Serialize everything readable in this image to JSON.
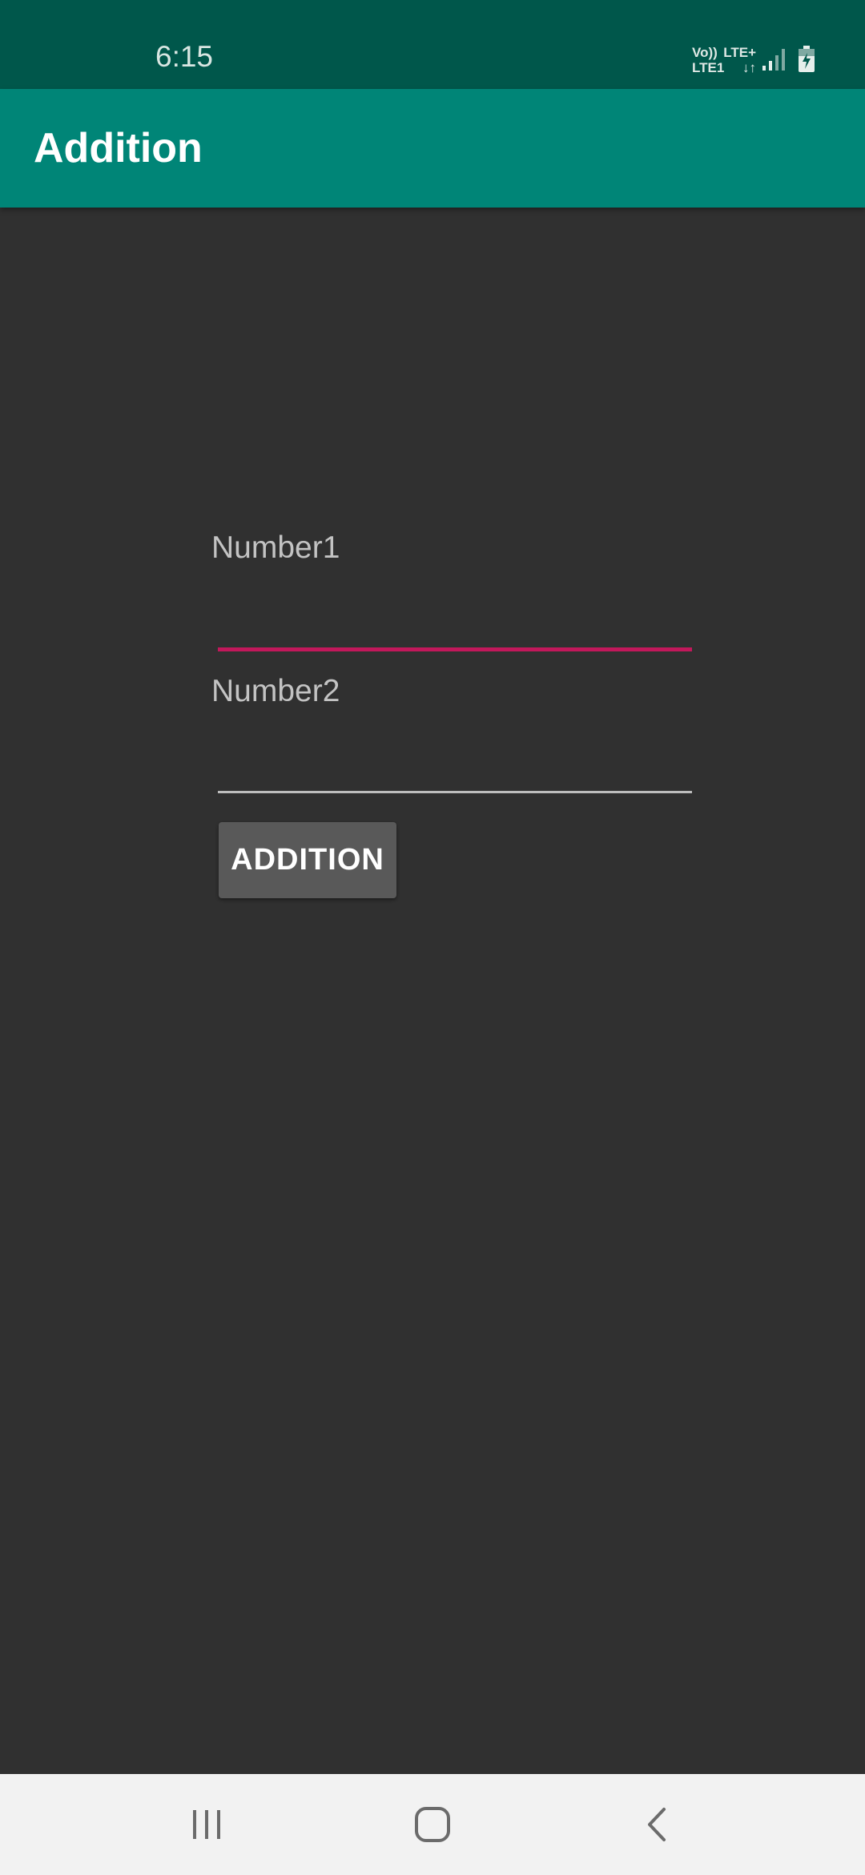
{
  "status_bar": {
    "time": "6:15",
    "network_top_left": "Vo))",
    "network_top_right": "LTE+",
    "network_bottom_left": "LTE1",
    "network_bottom_right": "↓↑",
    "icons": [
      "signal-icon",
      "battery-charging-icon"
    ]
  },
  "app_bar": {
    "title": "Addition"
  },
  "form": {
    "number1_label": "Number1",
    "number1_value": "",
    "number2_label": "Number2",
    "number2_value": "",
    "addition_button_label": "ADDITION"
  },
  "nav_bar": {
    "icons": [
      "recent-apps-icon",
      "home-icon",
      "back-icon"
    ]
  },
  "colors": {
    "status_bar": "#00574B",
    "app_bar": "#008577",
    "background": "#303030",
    "focused_underline": "#C2185B",
    "unfocused_underline": "#BDBDBD",
    "button": "#595959",
    "nav_bar": "#F2F2F2"
  }
}
